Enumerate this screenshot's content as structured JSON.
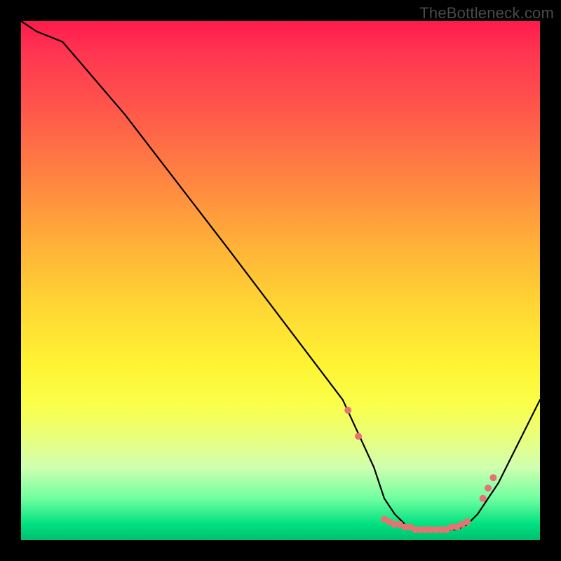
{
  "watermark": "TheBottleneck.com",
  "chart_data": {
    "type": "line",
    "title": "",
    "xlabel": "",
    "ylabel": "",
    "xlim": [
      0,
      100
    ],
    "ylim": [
      0,
      100
    ],
    "grid": false,
    "series": [
      {
        "name": "curve",
        "x": [
          0,
          3,
          8,
          20,
          40,
          62,
          68,
          70,
          72,
          74,
          76,
          78,
          80,
          82,
          84,
          86,
          88,
          92,
          100
        ],
        "y": [
          100,
          98,
          96,
          82,
          56,
          27,
          14,
          8,
          5,
          3,
          2,
          2,
          2,
          2,
          2,
          3,
          5,
          11,
          27
        ]
      }
    ],
    "markers": {
      "name": "dots",
      "color": "#e57373",
      "x": [
        63,
        65,
        70,
        71,
        72,
        73,
        74,
        75,
        76,
        77,
        78,
        79,
        80,
        81,
        82,
        83,
        84,
        85,
        86,
        89,
        90,
        91
      ],
      "y": [
        25,
        20,
        4,
        3.5,
        3,
        3,
        2.5,
        2.5,
        2,
        2,
        2,
        2,
        2,
        2,
        2,
        2.5,
        2.5,
        3,
        3.5,
        8,
        10,
        12
      ]
    }
  }
}
